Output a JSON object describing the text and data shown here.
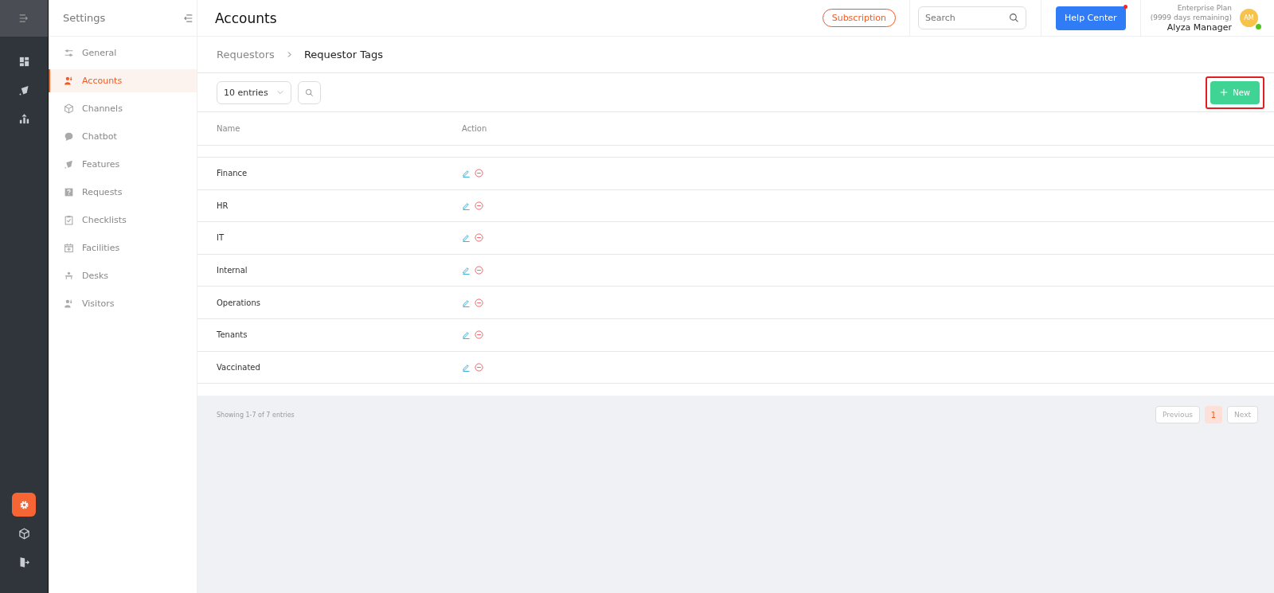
{
  "rail": {
    "top": [
      {
        "kind": "dashboard",
        "selected": false
      },
      {
        "kind": "rocket",
        "selected": false
      },
      {
        "kind": "chart",
        "selected": false
      }
    ],
    "bottom": [
      {
        "kind": "settings",
        "selected": true
      },
      {
        "kind": "cube",
        "selected": false
      },
      {
        "kind": "exit",
        "selected": false
      }
    ]
  },
  "sidebar": {
    "title": "Settings",
    "items": [
      {
        "label": "General",
        "kind": "sliders",
        "selected": false
      },
      {
        "label": "Accounts",
        "kind": "users",
        "selected": true
      },
      {
        "label": "Channels",
        "kind": "cube",
        "selected": false
      },
      {
        "label": "Chatbot",
        "kind": "bubble",
        "selected": false
      },
      {
        "label": "Features",
        "kind": "rocket",
        "selected": false
      },
      {
        "label": "Requests",
        "kind": "question",
        "selected": false
      },
      {
        "label": "Checklists",
        "kind": "clipboard",
        "selected": false
      },
      {
        "label": "Facilities",
        "kind": "calendar",
        "selected": false
      },
      {
        "label": "Desks",
        "kind": "desk",
        "selected": false
      },
      {
        "label": "Visitors",
        "kind": "users",
        "selected": false
      }
    ]
  },
  "header": {
    "title": "Accounts",
    "subscription": "Subscription",
    "search": {
      "placeholder": "Search"
    },
    "help": {
      "label": "Help Center",
      "notification": true
    },
    "user": {
      "plan": "Enterprise Plan",
      "remaining": "(9999 days remaining)",
      "name": "Alyza Manager",
      "initials": "AM",
      "online": true
    }
  },
  "breadcrumb": [
    {
      "label": "Requestors",
      "current": false
    },
    {
      "label": "Requestor Tags",
      "current": true
    }
  ],
  "toolbar": {
    "entries": "10 entries",
    "new_button": {
      "label": "New",
      "highlighted": true
    }
  },
  "table": {
    "columns": [
      "Name",
      "Action"
    ],
    "rows": [
      {
        "name": "Finance"
      },
      {
        "name": "HR"
      },
      {
        "name": "IT"
      },
      {
        "name": "Internal"
      },
      {
        "name": "Operations"
      },
      {
        "name": "Tenants"
      },
      {
        "name": "Vaccinated"
      }
    ]
  },
  "footer": {
    "summary": "Showing 1-7 of 7 entries",
    "previous": "Previous",
    "pages": [
      {
        "label": "1",
        "selected": true
      }
    ],
    "next": "Next"
  }
}
